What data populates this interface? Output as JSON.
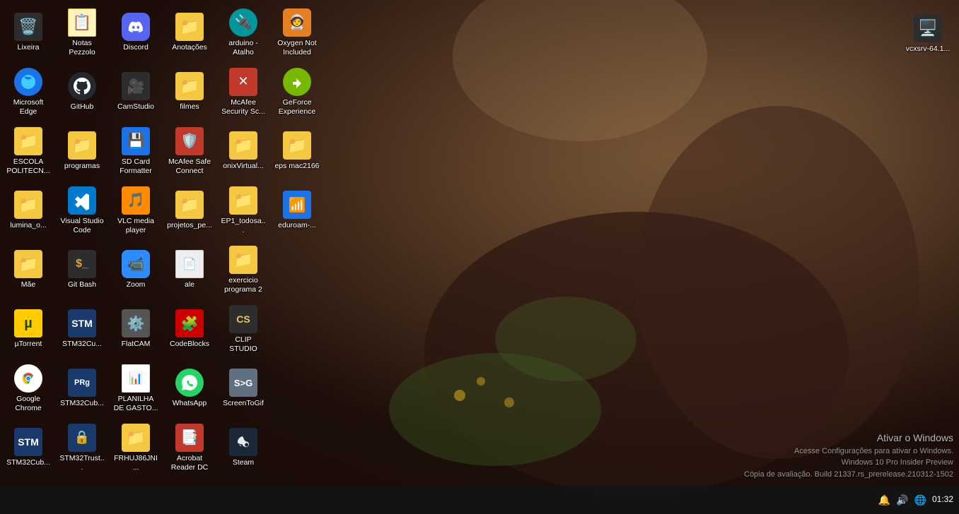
{
  "wallpaper": {
    "description": "Fantasy nature scene with bird and machinery"
  },
  "desktop_icons": [
    {
      "col": 1,
      "icons": [
        {
          "id": "lixeira",
          "label": "Lixeira",
          "emoji": "🗑️",
          "bg": "bg-dark"
        },
        {
          "id": "microsoft-edge",
          "label": "Microsoft Edge",
          "emoji": "🌐",
          "bg": "bg-blue"
        },
        {
          "id": "escola-politecn",
          "label": "ESCOLA POLITECN...",
          "emoji": "📁",
          "bg": "bg-folder"
        },
        {
          "id": "lumina-o",
          "label": "lumina_o...",
          "emoji": "📁",
          "bg": "bg-folder"
        },
        {
          "id": "mae",
          "label": "Mãe",
          "emoji": "📁",
          "bg": "bg-folder"
        },
        {
          "id": "utorrent",
          "label": "µTorrent",
          "emoji": "⬇",
          "bg": "bg-utor"
        },
        {
          "id": "google-chrome-taskbar",
          "label": "",
          "emoji": "",
          "bg": ""
        }
      ]
    },
    {
      "col": 2,
      "icons": [
        {
          "id": "notas-pezzolo",
          "label": "Notas Pezzolo",
          "emoji": "📄",
          "bg": "bg-white"
        },
        {
          "id": "github",
          "label": "GitHub",
          "emoji": "🐱",
          "bg": "bg-github"
        },
        {
          "id": "programas",
          "label": "programas",
          "emoji": "📁",
          "bg": "bg-folder"
        },
        {
          "id": "git-bash",
          "label": "Git Bash",
          "emoji": "💻",
          "bg": "bg-dark"
        },
        {
          "id": "stm32cu",
          "label": "STM32Cu...",
          "emoji": "🔷",
          "bg": "bg-navy"
        },
        {
          "id": "stm32cub2",
          "label": "STM32Cub...",
          "emoji": "🔧",
          "bg": "bg-navy"
        }
      ]
    },
    {
      "col": 3,
      "icons": [
        {
          "id": "stm32trust",
          "label": "STM32Trust...",
          "emoji": "🔒",
          "bg": "bg-navy"
        },
        {
          "id": "discord",
          "label": "Discord",
          "emoji": "🎮",
          "bg": "bg-discord"
        },
        {
          "id": "camstudio",
          "label": "CamStudio",
          "emoji": "🎥",
          "bg": "bg-dark"
        },
        {
          "id": "sd-card-formatter",
          "label": "SD Card Formatter",
          "emoji": "💾",
          "bg": "bg-blue"
        },
        {
          "id": "vlc-media-player",
          "label": "VLC media player",
          "emoji": "🎵",
          "bg": "bg-vlc"
        },
        {
          "id": "zoom",
          "label": "Zoom",
          "emoji": "📹",
          "bg": "bg-zoom"
        }
      ]
    },
    {
      "col": 4,
      "icons": [
        {
          "id": "flatcam",
          "label": "FlatCAM",
          "emoji": "⚙️",
          "bg": "bg-gray"
        },
        {
          "id": "planilha-de-gasto",
          "label": "PLANILHA DE GASTO...",
          "emoji": "📊",
          "bg": "bg-white"
        },
        {
          "id": "frhuj86jni",
          "label": "FRHUJ86JNI...",
          "emoji": "📁",
          "bg": "bg-folder"
        },
        {
          "id": "anotacoes",
          "label": "Anotações",
          "emoji": "📁",
          "bg": "bg-folder"
        },
        {
          "id": "filmes",
          "label": "filmes",
          "emoji": "📁",
          "bg": "bg-folder"
        },
        {
          "id": "mcafee-safe-connect",
          "label": "McAfee Safe Connect",
          "emoji": "🛡️",
          "bg": "bg-mcafee"
        },
        {
          "id": "projetos-pe",
          "label": "projetos_pe...",
          "emoji": "📁",
          "bg": "bg-folder"
        }
      ]
    },
    {
      "col": 5,
      "icons": [
        {
          "id": "ale",
          "label": "ale",
          "emoji": "📄",
          "bg": "bg-white"
        },
        {
          "id": "codeblocks",
          "label": "CodeBlocks",
          "emoji": "🧩",
          "bg": "bg-red"
        },
        {
          "id": "whatsapp",
          "label": "WhatsApp",
          "emoji": "💬",
          "bg": "bg-whatsapp"
        },
        {
          "id": "acrobat-reader-dc",
          "label": "Acrobat Reader DC",
          "emoji": "📑",
          "bg": "bg-acrobat"
        },
        {
          "id": "arduino-atalho",
          "label": "arduino - Atalho",
          "emoji": "🔌",
          "bg": "bg-teal"
        },
        {
          "id": "mcafee-security-sc",
          "label": "McAfee Security Sc...",
          "emoji": "🔴",
          "bg": "bg-mcafee"
        }
      ]
    },
    {
      "col": 6,
      "icons": [
        {
          "id": "onix-virtual",
          "label": "onixVirtual...",
          "emoji": "📁",
          "bg": "bg-folder"
        },
        {
          "id": "ep1-todosa",
          "label": "EP1_todosa...",
          "emoji": "📁",
          "bg": "bg-folder"
        },
        {
          "id": "exercicio-programa-2",
          "label": "exercicio programa 2",
          "emoji": "📁",
          "bg": "bg-folder"
        },
        {
          "id": "clip-studio",
          "label": "CLIP STUDIO",
          "emoji": "🎨",
          "bg": "bg-dark"
        },
        {
          "id": "screentogif",
          "label": "ScreenToGif",
          "emoji": "🎬",
          "bg": "bg-gray"
        },
        {
          "id": "steam",
          "label": "Steam",
          "emoji": "🎮",
          "bg": "bg-steam"
        },
        {
          "id": "oxygen-not-included",
          "label": "Oxygen Not Included",
          "emoji": "🧑‍🚀",
          "bg": "bg-orange"
        }
      ]
    },
    {
      "col": 7,
      "icons": [
        {
          "id": "geforce-experience",
          "label": "GeForce Experience",
          "emoji": "🎯",
          "bg": "bg-green"
        },
        {
          "id": "eps-mac2166",
          "label": "eps mac2166",
          "emoji": "📁",
          "bg": "bg-folder"
        },
        {
          "id": "eduroam",
          "label": "eduroam-...",
          "emoji": "📶",
          "bg": "bg-blue"
        }
      ]
    }
  ],
  "top_right_icon": {
    "label": "vcxsrv-64.1...",
    "emoji": "🖥️",
    "bg": "bg-dark"
  },
  "visual_studio_code": {
    "label": "Visual Studio Code",
    "emoji": "💙",
    "bg": "bg-blue"
  },
  "activation": {
    "title": "Ativar o Windows",
    "line1": "Acesse Configurações para ativar o Windows.",
    "line2": "Windows 10 Pro Insider Preview",
    "line3": "Cópia de avaliação. Build 21337.rs_prerelease.210312-1502"
  },
  "clock": {
    "time": "01:32",
    "date": ""
  },
  "taskbar_icons": [
    "🔔",
    "🔊",
    "🌐"
  ]
}
